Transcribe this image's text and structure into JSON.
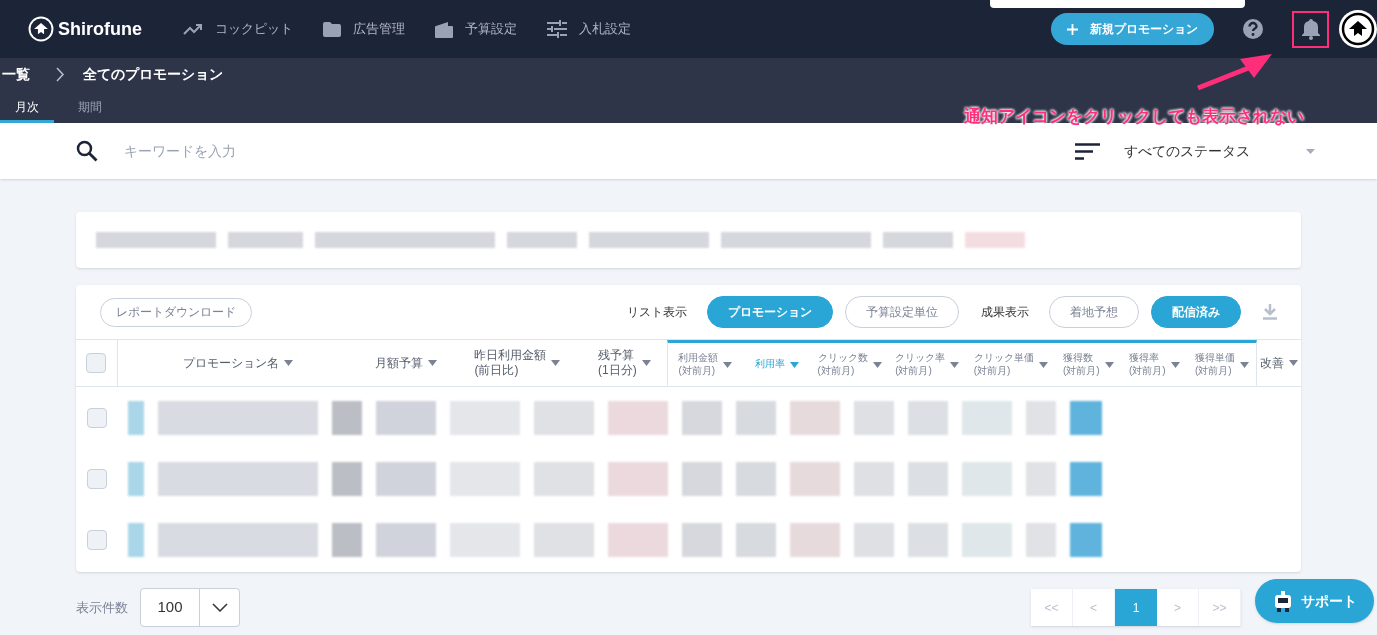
{
  "nav": {
    "logo": "Shirofune",
    "items": [
      {
        "label": "コックピット"
      },
      {
        "label": "広告管理"
      },
      {
        "label": "予算設定"
      },
      {
        "label": "入札設定"
      }
    ],
    "new_button": "新規プロモーション"
  },
  "breadcrumb": [
    "一覧",
    "全てのプロモーション"
  ],
  "tabs": [
    {
      "label": "月次",
      "selected": true
    },
    {
      "label": "期間",
      "selected": false
    }
  ],
  "search": {
    "placeholder": "キーワードを入力"
  },
  "status_filter": "すべてのステータス",
  "toolbar": {
    "download": "レポートダウンロード",
    "list_label": "リスト表示",
    "list_options": [
      {
        "label": "プロモーション",
        "selected": true
      },
      {
        "label": "予算設定単位",
        "selected": false
      }
    ],
    "result_label": "成果表示",
    "result_options": [
      {
        "label": "着地予想",
        "selected": false
      },
      {
        "label": "配信済み",
        "selected": true
      }
    ]
  },
  "select_all": {
    "checked": false
  },
  "columns": [
    {
      "label": "プロモーション名",
      "kind": "base",
      "selected": false
    },
    {
      "label": "月額予算",
      "kind": "base",
      "selected": false
    },
    {
      "label": "昨日利用金額",
      "sub": "(前日比)",
      "kind": "base",
      "selected": false
    },
    {
      "label": "残予算",
      "sub": "(1日分)",
      "kind": "base",
      "selected": false
    },
    {
      "label": "利用金額",
      "sub": "(対前月)",
      "kind": "result",
      "selected": false
    },
    {
      "label": "利用率",
      "kind": "result",
      "selected": true
    },
    {
      "label": "クリック数",
      "sub": "(対前月)",
      "kind": "result",
      "selected": false
    },
    {
      "label": "クリック率",
      "sub": "(対前月)",
      "kind": "result",
      "selected": false
    },
    {
      "label": "クリック単価",
      "sub": "(対前月)",
      "kind": "result",
      "selected": false
    },
    {
      "label": "獲得数",
      "sub": "(対前月)",
      "kind": "result",
      "selected": false
    },
    {
      "label": "獲得率",
      "sub": "(対前月)",
      "kind": "result",
      "selected": false
    },
    {
      "label": "獲得単価",
      "sub": "(対前月)",
      "kind": "result",
      "selected": false
    },
    {
      "label": "改善",
      "kind": "tail",
      "selected": false
    }
  ],
  "rows": [
    {
      "checked": false
    },
    {
      "checked": false
    },
    {
      "checked": false
    }
  ],
  "footer": {
    "page_size_label": "表示件数",
    "page_size": "100",
    "pages": [
      {
        "label": "<<",
        "selected": false
      },
      {
        "label": "<",
        "selected": false
      },
      {
        "label": "1",
        "selected": true
      },
      {
        "label": ">",
        "selected": false
      },
      {
        "label": ">>",
        "selected": false
      }
    ]
  },
  "support": "サポート",
  "annotation": "通知アイコンをクリックしても表示されない"
}
